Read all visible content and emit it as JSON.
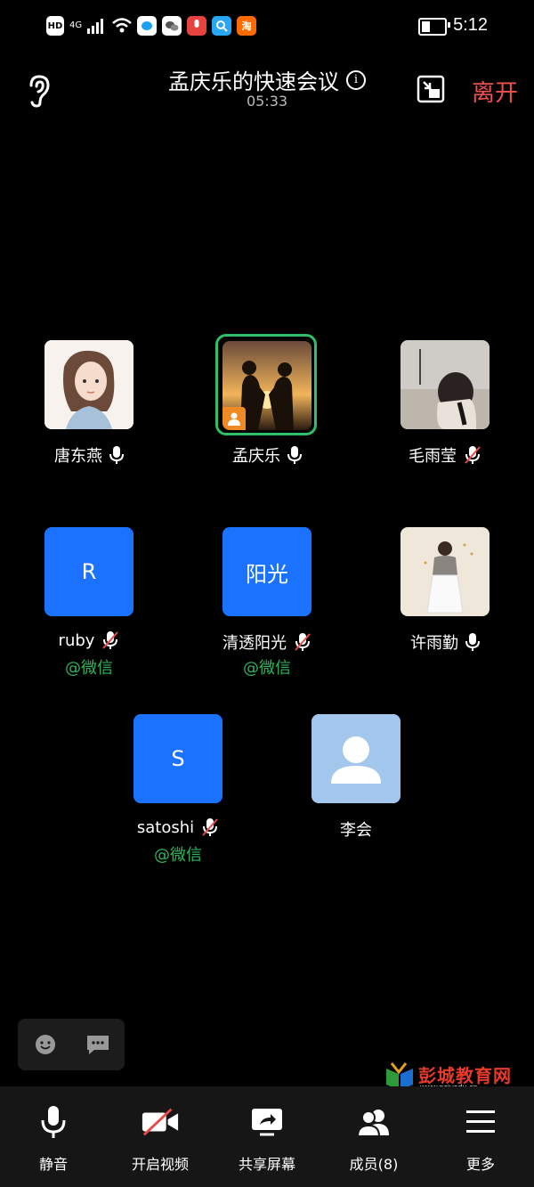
{
  "status_bar": {
    "left_icons": [
      "HD",
      "4G",
      "signal-icon",
      "wifi-icon",
      "qq-icon",
      "wechat-icon",
      "recorder-icon",
      "search-app-icon",
      "taobao-icon"
    ],
    "time": "5:12",
    "taobao_label": "淘"
  },
  "header": {
    "title": "孟庆乐的快速会议",
    "timer": "05:33",
    "leave_label": "离开",
    "info_glyph": "i"
  },
  "participants": [
    {
      "name": "唐东燕",
      "mic": "on",
      "avatar_type": "photo"
    },
    {
      "name": "孟庆乐",
      "mic": "on",
      "avatar_type": "photo",
      "speaking": true
    },
    {
      "name": "毛雨莹",
      "mic": "muted",
      "avatar_type": "photo"
    },
    {
      "name": "ruby",
      "mic": "muted",
      "avatar_type": "letter",
      "avatar_text": "R",
      "source": "@微信"
    },
    {
      "name": "清透阳光",
      "mic": "muted",
      "avatar_type": "letter",
      "avatar_text": "阳光",
      "source": "@微信"
    },
    {
      "name": "许雨勤",
      "mic": "on",
      "avatar_type": "photo"
    },
    {
      "name": "satoshi",
      "mic": "muted",
      "avatar_type": "letter",
      "avatar_text": "S",
      "source": "@微信"
    },
    {
      "name": "李会",
      "mic": "none",
      "avatar_type": "default"
    }
  ],
  "toolbar": {
    "mute_label": "静音",
    "video_label": "开启视频",
    "share_label": "共享屏幕",
    "members_label": "成员(8)",
    "more_label": "更多"
  },
  "watermark": {
    "text": "彭城教育网",
    "url": "www.pcjyedu.cn"
  },
  "colors": {
    "accent_blue": "#1a72ff",
    "leave_red": "#f0514c",
    "speaking_green": "#2fbf68",
    "wechat_green": "#33b35a",
    "bottom_bar": "#161616"
  }
}
